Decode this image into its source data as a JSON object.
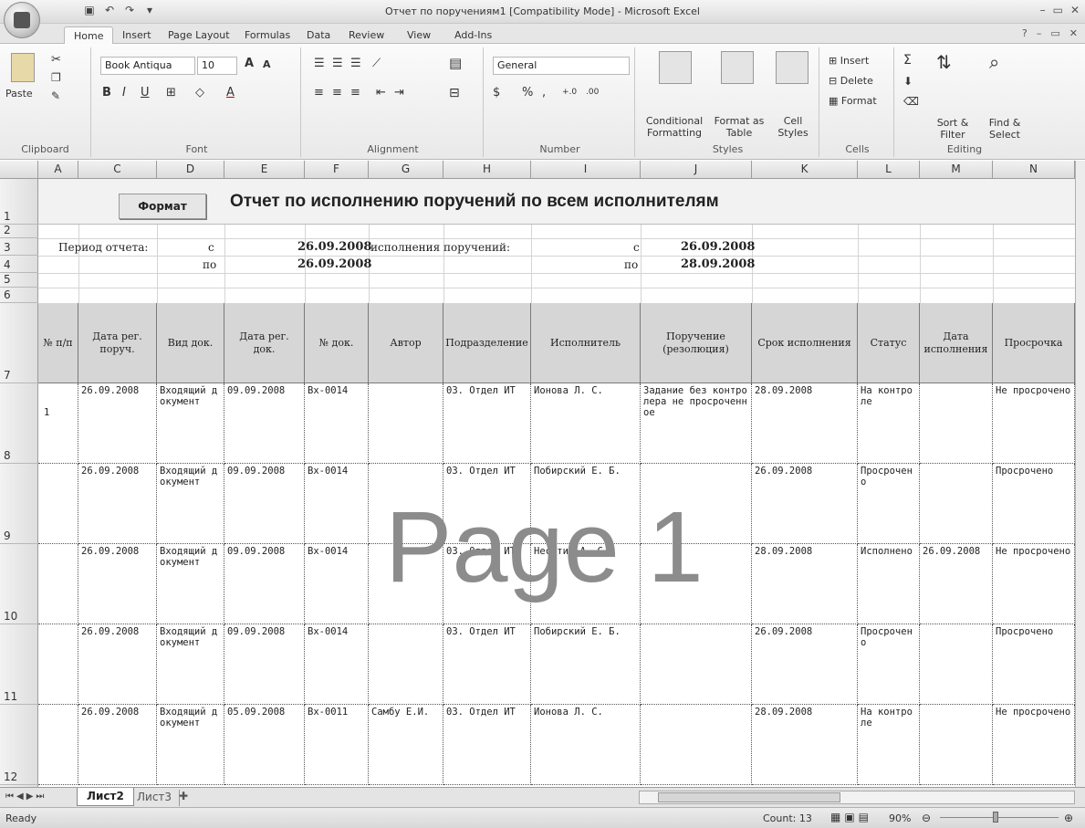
{
  "window": {
    "title": "Отчет по поручениям1  [Compatibility Mode] - Microsoft Excel"
  },
  "ribbon": {
    "tabs": [
      "Home",
      "Insert",
      "Page Layout",
      "Formulas",
      "Data",
      "Review",
      "View",
      "Add-Ins"
    ],
    "clipboard": {
      "paste": "Paste",
      "label": "Clipboard"
    },
    "font": {
      "name": "Book Antiqua",
      "size": "10",
      "label": "Font"
    },
    "alignment": {
      "label": "Alignment"
    },
    "number": {
      "format": "General",
      "label": "Number"
    },
    "styles": {
      "conditional": "Conditional Formatting",
      "format_table": "Format as Table",
      "cell_styles": "Cell Styles",
      "label": "Styles"
    },
    "cells": {
      "insert": "Insert",
      "delete": "Delete",
      "format": "Format",
      "label": "Cells"
    },
    "editing": {
      "sort": "Sort & Filter",
      "find": "Find & Select",
      "label": "Editing"
    }
  },
  "columns": [
    "A",
    "C",
    "D",
    "E",
    "F",
    "G",
    "H",
    "I",
    "J",
    "K",
    "L",
    "M",
    "N"
  ],
  "rows": [
    "1",
    "2",
    "3",
    "4",
    "5",
    "6",
    "7",
    "8",
    "9",
    "10",
    "11",
    "12"
  ],
  "sheet": {
    "format_button": "Формат",
    "report_title": "Отчет по исполнению поручений по всем исполнителям",
    "period_label": "Период отчета:",
    "from_label": "с",
    "to_label": "по",
    "period_from": "26.09.2008",
    "period_to": "26.09.2008",
    "exec_label": "исполнения поручений:",
    "exec_from_label": "с",
    "exec_to_label": "по",
    "exec_from": "26.09.2008",
    "exec_to": "28.09.2008",
    "headers": [
      "№ п/п",
      "Дата рег. поруч.",
      "Вид док.",
      "Дата рег. док.",
      "№ док.",
      "Автор",
      "Подразделение",
      "Исполнитель",
      "Поручение (резолюция)",
      "Срок исполнения",
      "Статус",
      "Дата исполнения",
      "Просрочка"
    ],
    "data_rows": [
      {
        "num": "1",
        "date_reg": "26.09.2008",
        "doc_type": "Входящий документ",
        "doc_date": "09.09.2008",
        "doc_no": "Вх-0014",
        "author": "",
        "dept": "03. Отдел ИТ",
        "executor": "Ионова Л. С.",
        "order": "Задание без контролера не просроченное",
        "deadline": "28.09.2008",
        "status": "На контроле",
        "exec_date": "",
        "overdue": "Не просрочено"
      },
      {
        "num": "",
        "date_reg": "26.09.2008",
        "doc_type": "Входящий документ",
        "doc_date": "09.09.2008",
        "doc_no": "Вх-0014",
        "author": "",
        "dept": "03. Отдел ИТ",
        "executor": "Побирский Е. Б.",
        "order": "",
        "deadline": "26.09.2008",
        "status": "Просрочено",
        "exec_date": "",
        "overdue": "Просрочено"
      },
      {
        "num": "",
        "date_reg": "26.09.2008",
        "doc_type": "Входящий документ",
        "doc_date": "09.09.2008",
        "doc_no": "Вх-0014",
        "author": "",
        "dept": "03. Отдел ИТ",
        "executor": "Неситин А. С.",
        "order": "",
        "deadline": "28.09.2008",
        "status": "Исполнено",
        "exec_date": "26.09.2008",
        "overdue": "Не просрочено"
      },
      {
        "num": "",
        "date_reg": "26.09.2008",
        "doc_type": "Входящий документ",
        "doc_date": "09.09.2008",
        "doc_no": "Вх-0014",
        "author": "",
        "dept": "03. Отдел ИТ",
        "executor": "Побирский Е. Б.",
        "order": "",
        "deadline": "26.09.2008",
        "status": "Просрочено",
        "exec_date": "",
        "overdue": "Просрочено"
      },
      {
        "num": "",
        "date_reg": "26.09.2008",
        "doc_type": "Входящий документ",
        "doc_date": "05.09.2008",
        "doc_no": "Вх-0011",
        "author": "Самбу Е.И.",
        "dept": "03. Отдел ИТ",
        "executor": "Ионова Л. С.",
        "order": "",
        "deadline": "28.09.2008",
        "status": "На контроле",
        "exec_date": "",
        "overdue": "Не просрочено"
      }
    ],
    "watermark": "Page 1"
  },
  "sheet_tabs": [
    "Лист2",
    "Лист3"
  ],
  "status": {
    "ready": "Ready",
    "count": "Count: 13",
    "zoom": "90%"
  }
}
